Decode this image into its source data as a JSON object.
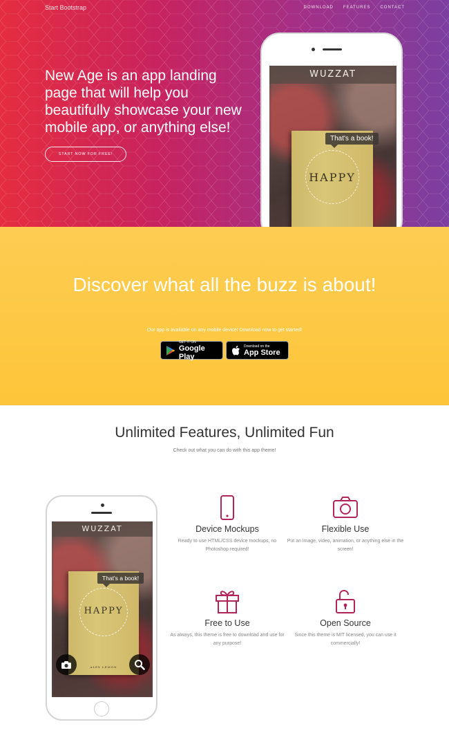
{
  "nav": {
    "brand": "Start Bootstrap",
    "links": [
      "Download",
      "Features",
      "Contact"
    ]
  },
  "hero": {
    "headline": "New Age is an app landing page that will help you beautifully showcase your new mobile app, or anything else!",
    "cta": "Start Now for Free!"
  },
  "phone_screen": {
    "app_name": "WUZZAT",
    "bubble": "That's a book!",
    "book_title": "HAPPY",
    "book_author": "Alex Lemon"
  },
  "download": {
    "title": "Discover what all the buzz is about!",
    "subtitle": "Our app is available on any mobile device! Download now to get started!",
    "google": {
      "small": "GET IT ON",
      "big": "Google Play"
    },
    "apple": {
      "small": "Download on the",
      "big": "App Store"
    }
  },
  "features": {
    "title": "Unlimited Features, Unlimited Fun",
    "subtitle": "Check out what you can do with this app theme!",
    "items": [
      {
        "icon": "smartphone-icon",
        "title": "Device Mockups",
        "desc": "Ready to use HTML/CSS device mockups, no Photoshop required!"
      },
      {
        "icon": "camera-icon",
        "title": "Flexible Use",
        "desc": "Put an image, video, animation, or anything else in the screen!"
      },
      {
        "icon": "gift-icon",
        "title": "Free to Use",
        "desc": "As always, this theme is free to download and use for any purpose!"
      },
      {
        "icon": "unlock-icon",
        "title": "Open Source",
        "desc": "Since this theme is MIT licensed, you can use it commercially!"
      }
    ]
  },
  "colors": {
    "hero_gradient_start": "#e52d3f",
    "hero_gradient_end": "#7b3fa0",
    "download_yellow": "#fdcc52",
    "icon_accent": "#b0245a"
  }
}
